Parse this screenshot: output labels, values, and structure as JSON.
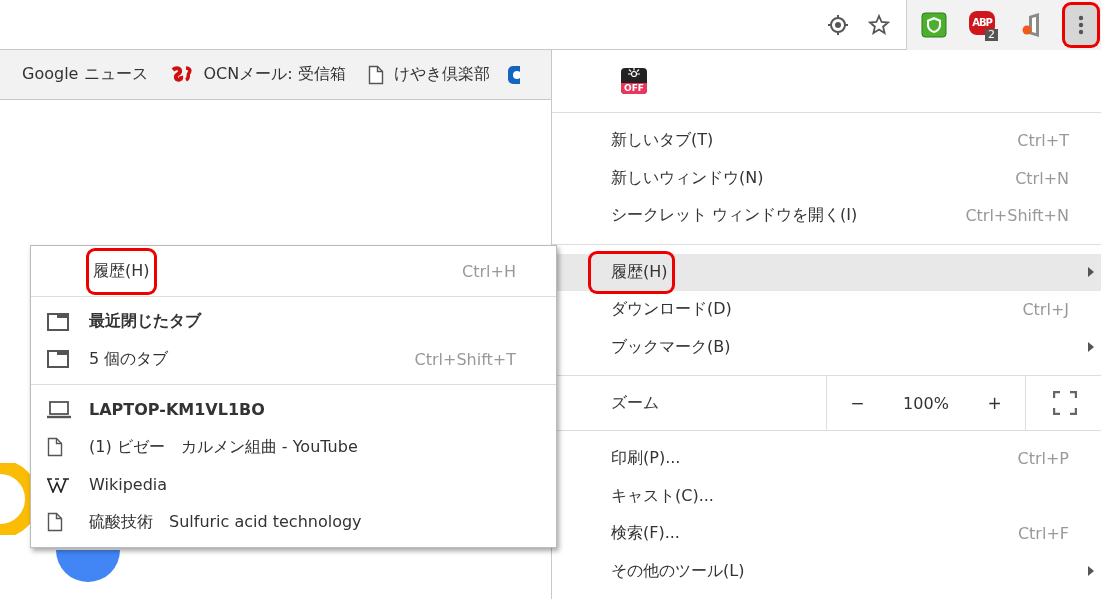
{
  "toolbar": {
    "extensions": [
      {
        "kind": "shield"
      },
      {
        "kind": "abp",
        "label": "ABP",
        "badge": "2"
      },
      {
        "kind": "office"
      }
    ],
    "menu_button": {
      "highlighted": true
    }
  },
  "bookmarks": [
    {
      "label": "Google ニュース",
      "kind": "none"
    },
    {
      "label": "OCNメール: 受信箱",
      "kind": "logo"
    },
    {
      "label": "けやき倶楽部",
      "kind": "page"
    }
  ],
  "menu": {
    "extension_icon": {
      "label": "OFF"
    },
    "sections": [
      {
        "items": [
          {
            "kind": "item",
            "label": "新しいタブ(T)",
            "shortcut": "Ctrl+T",
            "submenu": false,
            "selected": false,
            "highlighted": false
          },
          {
            "kind": "item",
            "label": "新しいウィンドウ(N)",
            "shortcut": "Ctrl+N",
            "submenu": false,
            "selected": false,
            "highlighted": false
          },
          {
            "kind": "item",
            "label": "シークレット ウィンドウを開く(I)",
            "shortcut": "Ctrl+Shift+N",
            "submenu": false,
            "selected": false,
            "highlighted": false
          }
        ]
      },
      {
        "items": [
          {
            "kind": "item",
            "label": "履歴(H)",
            "submenu": true,
            "selected": true,
            "highlighted": true
          },
          {
            "kind": "item",
            "label": "ダウンロード(D)",
            "shortcut": "Ctrl+J",
            "submenu": false,
            "selected": false,
            "highlighted": false
          },
          {
            "kind": "item",
            "label": "ブックマーク(B)",
            "submenu": true,
            "selected": false,
            "highlighted": false
          }
        ]
      },
      {
        "items": [
          {
            "kind": "zoom",
            "label": "ズーム",
            "minus": "−",
            "value": "100%",
            "plus": "+"
          }
        ]
      },
      {
        "items": [
          {
            "kind": "item",
            "label": "印刷(P)...",
            "shortcut": "Ctrl+P",
            "submenu": false,
            "selected": false,
            "highlighted": false
          },
          {
            "kind": "item",
            "label": "キャスト(C)...",
            "submenu": false,
            "selected": false,
            "highlighted": false
          },
          {
            "kind": "item",
            "label": "検索(F)...",
            "shortcut": "Ctrl+F",
            "submenu": false,
            "selected": false,
            "highlighted": false
          },
          {
            "kind": "item",
            "label": "その他のツール(L)",
            "submenu": true,
            "selected": false,
            "highlighted": false
          }
        ]
      }
    ]
  },
  "history_submenu": {
    "header": {
      "label": "履歴(H)",
      "shortcut": "Ctrl+H",
      "highlighted": true
    },
    "sections": [
      {
        "items": [
          {
            "kind": "tab",
            "label": "最近閉じたタブ",
            "bold": true
          },
          {
            "kind": "tab",
            "label": "5 個のタブ",
            "shortcut": "Ctrl+Shift+T",
            "bold": false
          }
        ]
      },
      {
        "items": [
          {
            "kind": "laptop",
            "label": "LAPTOP-KM1VL1BO",
            "bold": true
          },
          {
            "kind": "page",
            "label": "(1) ビゼー　カルメン組曲 - YouTube",
            "bold": false
          },
          {
            "kind": "wiki",
            "label": "Wikipedia",
            "bold": false
          },
          {
            "kind": "page",
            "label": "硫酸技術　Sulfuric acid technology",
            "bold": false
          }
        ]
      }
    ]
  }
}
